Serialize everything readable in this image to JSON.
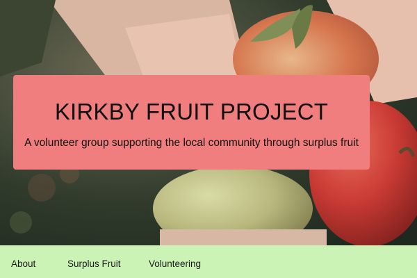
{
  "hero": {
    "image_description_icon": "apples-in-hands-photo-icon",
    "banner_color": "#f17e7e",
    "title": "KIRKBY FRUIT PROJECT",
    "tagline": "A volunteer group supporting the local community through surplus fruit"
  },
  "nav": {
    "background": "#cbf3b5",
    "items": [
      {
        "label": "About"
      },
      {
        "label": "Surplus Fruit"
      },
      {
        "label": "Volunteering"
      }
    ]
  }
}
